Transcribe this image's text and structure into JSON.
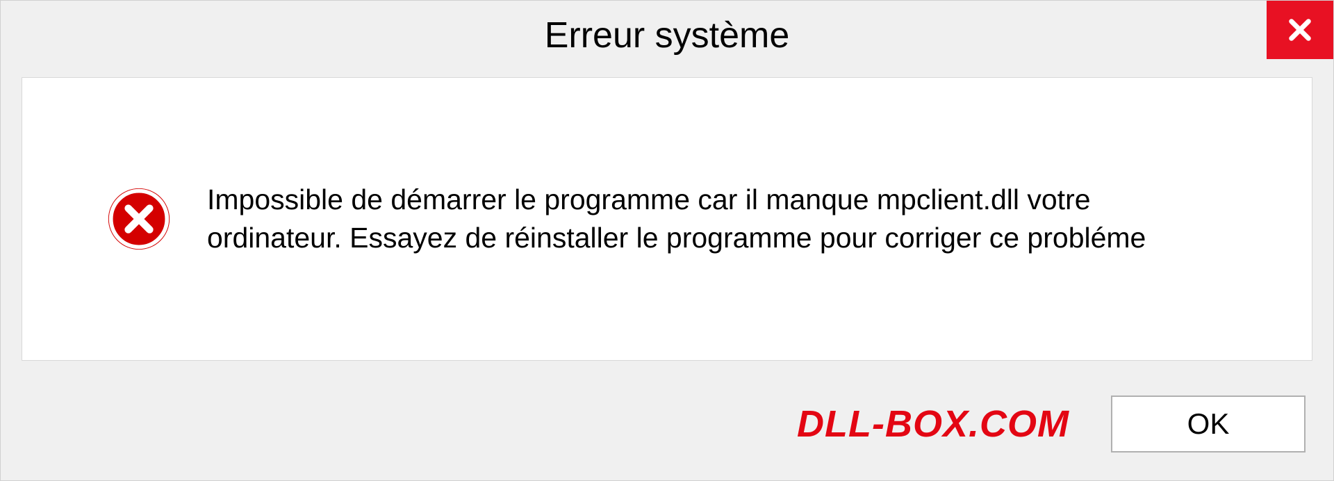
{
  "dialog": {
    "title": "Erreur système",
    "message": "Impossible de démarrer le programme car il manque mpclient.dll votre ordinateur. Essayez de réinstaller le programme pour corriger ce probléme",
    "ok_label": "OK"
  },
  "watermark": {
    "text": "DLL-BOX.COM"
  },
  "colors": {
    "close_bg": "#e81123",
    "error_icon": "#d40000",
    "watermark": "#e30613"
  }
}
